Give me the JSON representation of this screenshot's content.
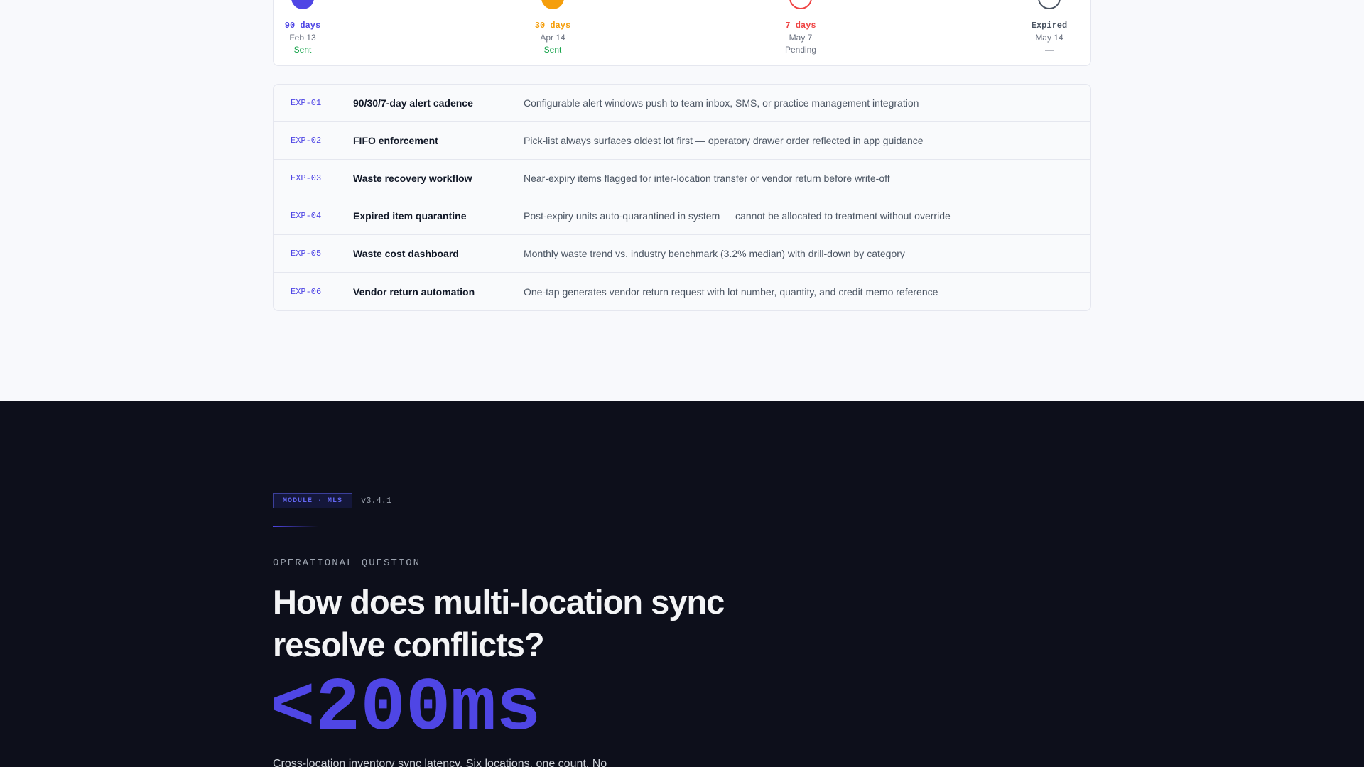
{
  "timeline": {
    "milestones": [
      {
        "label": "90 days",
        "date": "Feb 13",
        "status": "Sent",
        "color": "#4f46e5",
        "status_color": "#16a34a",
        "dot_style": "filled"
      },
      {
        "label": "30 days",
        "date": "Apr 14",
        "status": "Sent",
        "color": "#f59e0b",
        "status_color": "#16a34a",
        "dot_style": "filled"
      },
      {
        "label": "7 days",
        "date": "May 7",
        "status": "Pending",
        "color": "#ef4444",
        "status_color": "#6b7280",
        "dot_style": "outline"
      },
      {
        "label": "Expired",
        "date": "May 14",
        "status": "—",
        "color": "#4b5563",
        "status_color": "#6b7280",
        "dot_style": "outline"
      }
    ]
  },
  "features": [
    {
      "code": "EXP-01",
      "title": "90/30/7-day alert cadence",
      "desc": "Configurable alert windows push to team inbox, SMS, or practice management integration"
    },
    {
      "code": "EXP-02",
      "title": "FIFO enforcement",
      "desc": "Pick-list always surfaces oldest lot first — operatory drawer order reflected in app guidance"
    },
    {
      "code": "EXP-03",
      "title": "Waste recovery workflow",
      "desc": "Near-expiry items flagged for inter-location transfer or vendor return before write-off"
    },
    {
      "code": "EXP-04",
      "title": "Expired item quarantine",
      "desc": "Post-expiry units auto-quarantined in system — cannot be allocated to treatment without override"
    },
    {
      "code": "EXP-05",
      "title": "Waste cost dashboard",
      "desc": "Monthly waste trend vs. industry benchmark (3.2% median) with drill-down by category"
    },
    {
      "code": "EXP-06",
      "title": "Vendor return automation",
      "desc": "One-tap generates vendor return request with lot number, quantity, and credit memo reference"
    }
  ],
  "module": {
    "badge": "MODULE · MLS",
    "version": "v3.4.1",
    "eyebrow": "OPERATIONAL QUESTION",
    "headline": "How does multi-location sync resolve conflicts?",
    "stat": "<200ms",
    "caption": "Cross-location inventory sync latency. Six locations, one count. No"
  },
  "colors": {
    "accent": "#4f46e5",
    "dark_bg": "#0d0f1b"
  }
}
